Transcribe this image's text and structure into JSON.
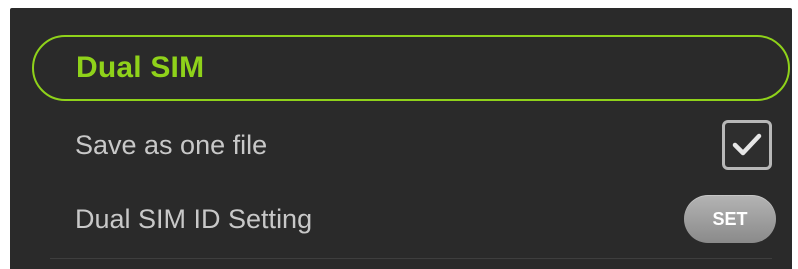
{
  "section": {
    "title": "Dual SIM"
  },
  "settings": [
    {
      "label": "Save as one file",
      "control": "checkbox",
      "checked": true
    },
    {
      "label": "Dual SIM ID Setting",
      "control": "button",
      "button_label": "SET"
    }
  ],
  "colors": {
    "background": "#2a2a2a",
    "accent": "#8fd21a",
    "label_text": "#c8c8c8",
    "button": "#9e9e9e"
  },
  "icons": {
    "checkbox_mark": "checkmark-icon"
  }
}
